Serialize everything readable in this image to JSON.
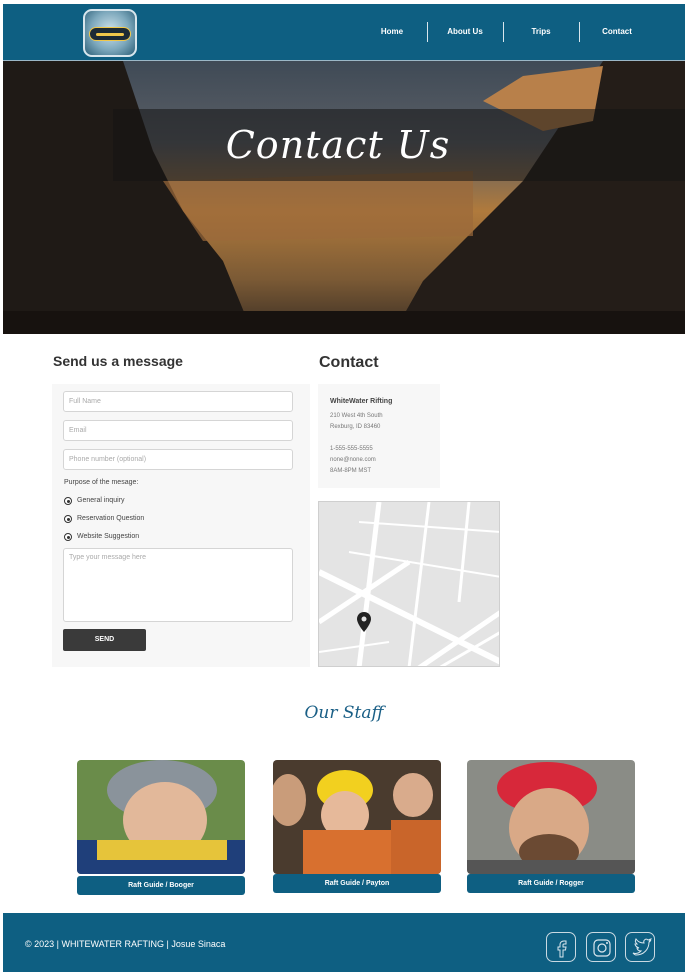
{
  "nav": {
    "items": [
      "Home",
      "About Us",
      "Trips",
      "Contact"
    ]
  },
  "hero": {
    "title": "Contact Us"
  },
  "form": {
    "heading": "Send us a message",
    "full_name_placeholder": "Full Name",
    "email_placeholder": "Email",
    "phone_placeholder": "Phone number (optional)",
    "purpose_label": "Purpose of the mesage:",
    "options": [
      "General inquiry",
      "Reservation Question",
      "Website Suggestion"
    ],
    "message_placeholder": "Type your message here",
    "send_label": "SEND"
  },
  "contact": {
    "heading": "Contact",
    "company": "WhiteWater Rifting",
    "address_line1": "210 West 4th South",
    "address_line2": "Rexburg, ID 83460",
    "phone": "1-555-555-5555",
    "email": "none@none.com",
    "hours": "8AM-8PM MST"
  },
  "staff": {
    "heading": "Our Staff",
    "members": [
      {
        "label": "Raft Guide / Booger"
      },
      {
        "label": "Raft Guide / Payton"
      },
      {
        "label": "Raft Guide / Rogger"
      }
    ]
  },
  "footer": {
    "copyright": "© 2023 | WHITEWATER  RAFTING |  Josue Sinaca"
  },
  "colors": {
    "brand": "#0e5f82",
    "button": "#3a3a3a",
    "panel": "#f7f7f7"
  },
  "icons": {
    "social": [
      "facebook-icon",
      "instagram-icon",
      "twitter-icon"
    ],
    "map_marker": "map-pin-icon"
  }
}
